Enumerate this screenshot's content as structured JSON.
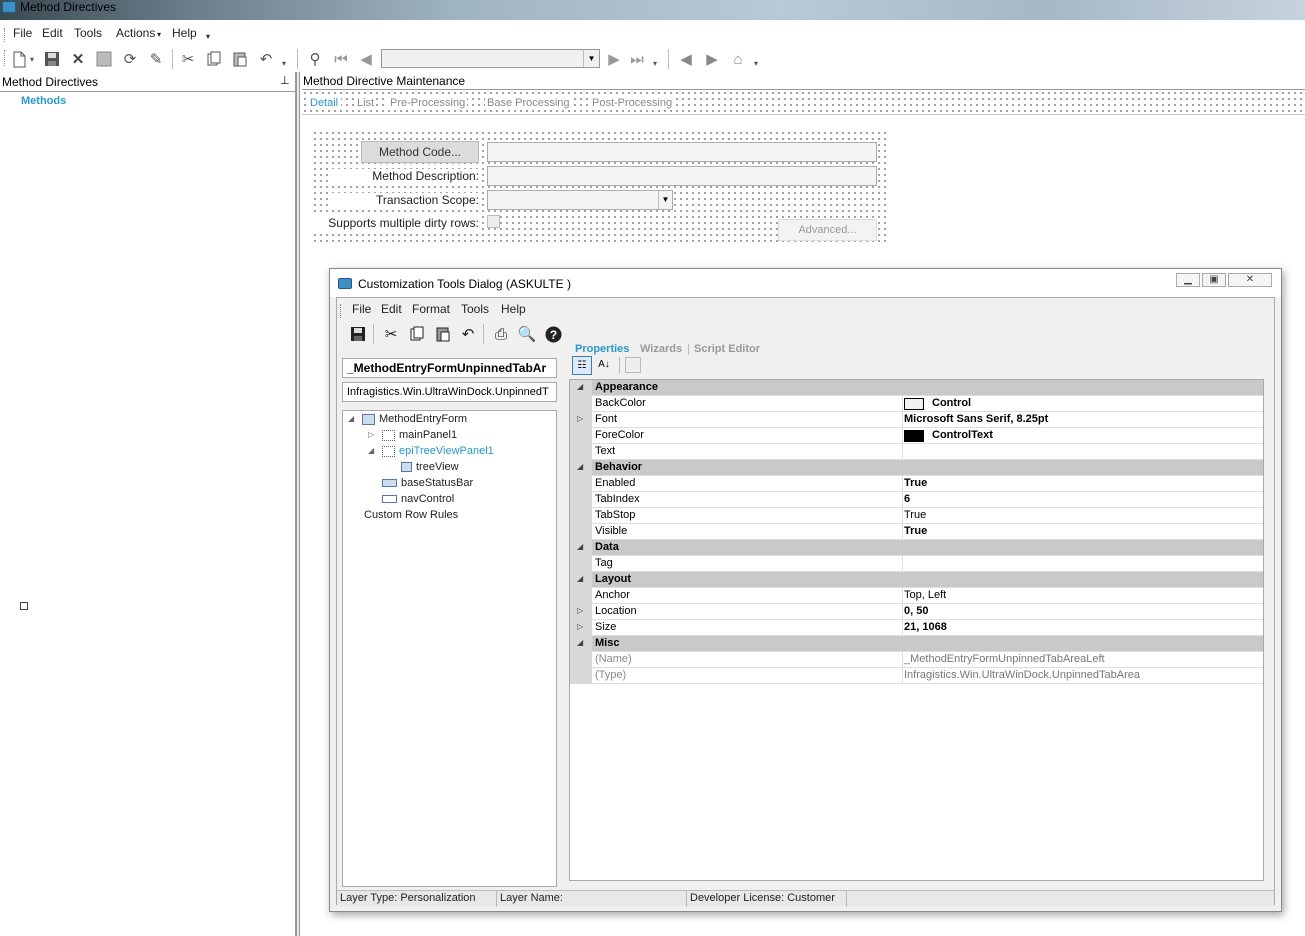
{
  "app": {
    "title": "Method Directives"
  },
  "menubar": {
    "items": [
      "File",
      "Edit",
      "Tools",
      "Actions",
      "Help"
    ]
  },
  "toolbar": {
    "nav_combo_value": ""
  },
  "left_pane": {
    "header": "Method Directives",
    "tree_item": "Methods"
  },
  "right_pane": {
    "header": "Method Directive Maintenance",
    "tabs": [
      "Detail",
      "List",
      "Pre-Processing",
      "Base Processing",
      "Post-Processing"
    ],
    "form": {
      "method_code_button": "Method Code...",
      "method_description_label": "Method Description:",
      "transaction_scope_label": "Transaction Scope:",
      "supports_dirty_rows_label": "Supports multiple dirty rows:",
      "advanced_button": "Advanced..."
    }
  },
  "dialog": {
    "title": "Customization Tools Dialog  (ASKULTE )",
    "menu": [
      "File",
      "Edit",
      "Format",
      "Tools",
      "Help"
    ],
    "tabs": [
      "Properties",
      "Wizards",
      "Script Editor"
    ],
    "selected_control": "_MethodEntryFormUnpinnedTabAr",
    "selected_type": "Infragistics.Win.UltraWinDock.UnpinnedT",
    "tree": [
      {
        "label": "MethodEntryForm"
      },
      {
        "label": "mainPanel1"
      },
      {
        "label": "epiTreeViewPanel1"
      },
      {
        "label": "treeView"
      },
      {
        "label": "baseStatusBar"
      },
      {
        "label": "navControl"
      },
      {
        "label": "Custom Row Rules"
      }
    ],
    "properties": [
      {
        "cat": "Appearance"
      },
      {
        "name": "BackColor",
        "value": "Control",
        "swatch": "#f0f0f0",
        "bold": true
      },
      {
        "name": "Font",
        "value": "Microsoft Sans Serif, 8.25pt",
        "expand": true,
        "bold": true
      },
      {
        "name": "ForeColor",
        "value": "ControlText",
        "swatch": "#000000",
        "bold": true
      },
      {
        "name": "Text",
        "value": ""
      },
      {
        "cat": "Behavior"
      },
      {
        "name": "Enabled",
        "value": "True",
        "bold": true
      },
      {
        "name": "TabIndex",
        "value": "6",
        "bold": true
      },
      {
        "name": "TabStop",
        "value": "True"
      },
      {
        "name": "Visible",
        "value": "True",
        "bold": true
      },
      {
        "cat": "Data"
      },
      {
        "name": "Tag",
        "value": ""
      },
      {
        "cat": "Layout"
      },
      {
        "name": "Anchor",
        "value": "Top, Left"
      },
      {
        "name": "Location",
        "value": "0, 50",
        "expand": true,
        "bold": true
      },
      {
        "name": "Size",
        "value": "21, 1068",
        "expand": true,
        "bold": true
      },
      {
        "cat": "Misc"
      },
      {
        "name": "(Name)",
        "value": "_MethodEntryFormUnpinnedTabAreaLeft",
        "gray": true
      },
      {
        "name": "(Type)",
        "value": "Infragistics.Win.UltraWinDock.UnpinnedTabArea",
        "gray": true
      }
    ],
    "status": {
      "layer_type": "Layer Type:  Personalization",
      "layer_name": "Layer Name:",
      "license": "Developer License:  Customer"
    }
  }
}
